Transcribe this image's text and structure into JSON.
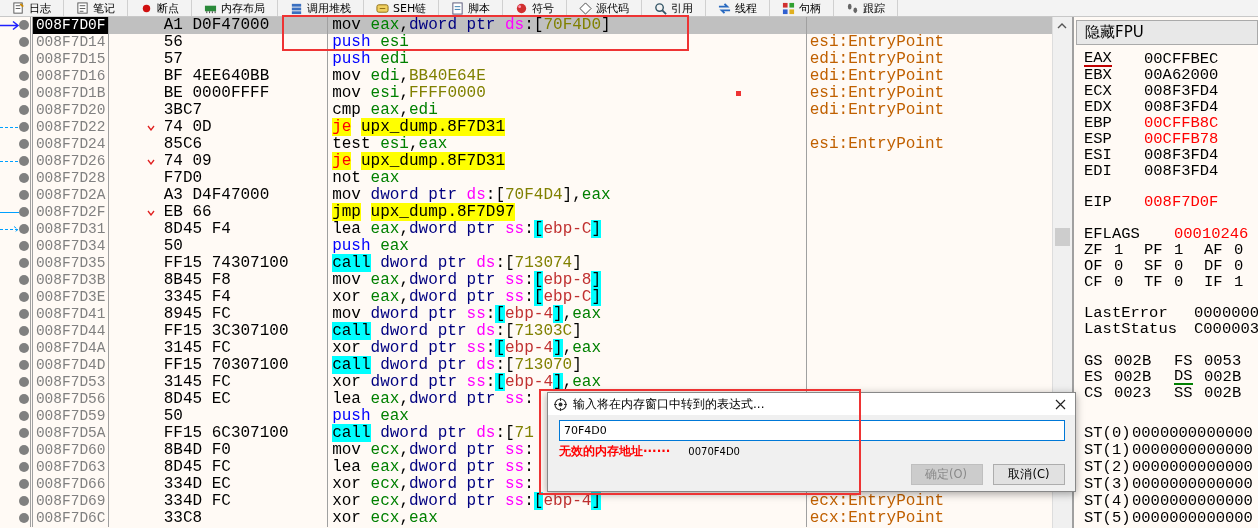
{
  "toolbar": {
    "tabs": [
      {
        "label": "日志"
      },
      {
        "label": "笔记"
      },
      {
        "label": "断点"
      },
      {
        "label": "内存布局"
      },
      {
        "label": "调用堆栈"
      },
      {
        "label": "SEH链"
      },
      {
        "label": "脚本"
      },
      {
        "label": "符号"
      },
      {
        "label": "源代码"
      },
      {
        "label": "引用"
      },
      {
        "label": "线程"
      },
      {
        "label": "句柄"
      },
      {
        "label": "跟踪"
      }
    ]
  },
  "disassembly": {
    "rows": [
      {
        "address": "008F7D0F",
        "bytes": "A1 D0F47000",
        "selected": true,
        "jump": false,
        "marker": {
          "kind": "eip"
        },
        "tokens": [
          {
            "kind": "plain",
            "text": "mov "
          },
          {
            "kind": "reg",
            "text": "eax"
          },
          {
            "kind": "plain",
            "text": ","
          },
          {
            "kind": "size",
            "text": "dword ptr "
          },
          {
            "kind": "seg",
            "text": "ds"
          },
          {
            "kind": "plain",
            "text": ":["
          },
          {
            "kind": "num",
            "text": "70F4D0"
          },
          {
            "kind": "plain",
            "text": "]"
          }
        ]
      },
      {
        "address": "008F7D14",
        "bytes": "56",
        "selected": false,
        "jump": false,
        "tokens": [
          {
            "kind": "push",
            "text": "push "
          },
          {
            "kind": "reg",
            "text": "esi"
          }
        ],
        "comment": "esi:EntryPoint"
      },
      {
        "address": "008F7D15",
        "bytes": "57",
        "selected": false,
        "jump": false,
        "tokens": [
          {
            "kind": "push",
            "text": "push "
          },
          {
            "kind": "reg",
            "text": "edi"
          }
        ],
        "comment": "edi:EntryPoint"
      },
      {
        "address": "008F7D16",
        "bytes": "BF 4EE640BB",
        "selected": false,
        "jump": false,
        "tokens": [
          {
            "kind": "plain",
            "text": "mov "
          },
          {
            "kind": "reg",
            "text": "edi"
          },
          {
            "kind": "plain",
            "text": ","
          },
          {
            "kind": "num",
            "text": "BB40E64E"
          }
        ],
        "comment": "edi:EntryPoint"
      },
      {
        "address": "008F7D1B",
        "bytes": "BE 0000FFFF",
        "selected": false,
        "jump": false,
        "tokens": [
          {
            "kind": "plain",
            "text": "mov "
          },
          {
            "kind": "reg",
            "text": "esi"
          },
          {
            "kind": "plain",
            "text": ","
          },
          {
            "kind": "num",
            "text": "FFFF0000"
          }
        ],
        "comment": "esi:EntryPoint"
      },
      {
        "address": "008F7D20",
        "bytes": "3BC7",
        "selected": false,
        "jump": false,
        "tokens": [
          {
            "kind": "plain",
            "text": "cmp "
          },
          {
            "kind": "reg",
            "text": "eax"
          },
          {
            "kind": "plain",
            "text": ","
          },
          {
            "kind": "reg",
            "text": "edi"
          }
        ],
        "comment": "edi:EntryPoint"
      },
      {
        "address": "008F7D22",
        "bytes": "74 0D",
        "selected": false,
        "jump": true,
        "marker": {
          "kind": "branch_dashed"
        },
        "tokens": [
          {
            "kind": "jcc",
            "text": "je "
          },
          {
            "kind": "target",
            "text": "upx_dump.8F7D31"
          }
        ]
      },
      {
        "address": "008F7D24",
        "bytes": "85C6",
        "selected": false,
        "jump": false,
        "tokens": [
          {
            "kind": "plain",
            "text": "test "
          },
          {
            "kind": "reg",
            "text": "esi"
          },
          {
            "kind": "plain",
            "text": ","
          },
          {
            "kind": "reg",
            "text": "eax"
          }
        ],
        "comment": "esi:EntryPoint"
      },
      {
        "address": "008F7D26",
        "bytes": "74 09",
        "selected": false,
        "jump": true,
        "marker": {
          "kind": "branch_dashed"
        },
        "tokens": [
          {
            "kind": "jcc",
            "text": "je "
          },
          {
            "kind": "target",
            "text": "upx_dump.8F7D31"
          }
        ]
      },
      {
        "address": "008F7D28",
        "bytes": "F7D0",
        "selected": false,
        "jump": false,
        "tokens": [
          {
            "kind": "plain",
            "text": "not "
          },
          {
            "kind": "reg",
            "text": "eax"
          }
        ]
      },
      {
        "address": "008F7D2A",
        "bytes": "A3 D4F47000",
        "selected": false,
        "jump": false,
        "tokens": [
          {
            "kind": "plain",
            "text": "mov "
          },
          {
            "kind": "size",
            "text": "dword ptr "
          },
          {
            "kind": "seg",
            "text": "ds"
          },
          {
            "kind": "plain",
            "text": ":["
          },
          {
            "kind": "num",
            "text": "70F4D4"
          },
          {
            "kind": "plain",
            "text": "],"
          },
          {
            "kind": "reg",
            "text": "eax"
          }
        ]
      },
      {
        "address": "008F7D2F",
        "bytes": "EB 66",
        "selected": false,
        "jump": true,
        "marker": {
          "kind": "branch_solid"
        },
        "tokens": [
          {
            "kind": "jmp",
            "text": "jmp "
          },
          {
            "kind": "target",
            "text": "upx_dump.8F7D97"
          }
        ]
      },
      {
        "address": "008F7D31",
        "bytes": "8D45 F4",
        "selected": false,
        "jump": false,
        "marker": {
          "kind": "target_dashed"
        },
        "tokens": [
          {
            "kind": "plain",
            "text": "lea "
          },
          {
            "kind": "reg",
            "text": "eax"
          },
          {
            "kind": "plain",
            "text": ","
          },
          {
            "kind": "size",
            "text": "dword ptr "
          },
          {
            "kind": "seg",
            "text": "ss"
          },
          {
            "kind": "plain",
            "text": ":"
          },
          {
            "kind": "mbr",
            "text": "["
          },
          {
            "kind": "stk",
            "text": "ebp-C"
          },
          {
            "kind": "mbr",
            "text": "]"
          }
        ]
      },
      {
        "address": "008F7D34",
        "bytes": "50",
        "selected": false,
        "jump": false,
        "tokens": [
          {
            "kind": "push",
            "text": "push "
          },
          {
            "kind": "reg",
            "text": "eax"
          }
        ]
      },
      {
        "address": "008F7D35",
        "bytes": "FF15 74307100",
        "selected": false,
        "jump": false,
        "tokens": [
          {
            "kind": "call",
            "text": "call "
          },
          {
            "kind": "size",
            "text": "dword ptr "
          },
          {
            "kind": "seg",
            "text": "ds"
          },
          {
            "kind": "plain",
            "text": ":["
          },
          {
            "kind": "num",
            "text": "713074"
          },
          {
            "kind": "plain",
            "text": "]"
          }
        ]
      },
      {
        "address": "008F7D3B",
        "bytes": "8B45 F8",
        "selected": false,
        "jump": false,
        "tokens": [
          {
            "kind": "plain",
            "text": "mov "
          },
          {
            "kind": "reg",
            "text": "eax"
          },
          {
            "kind": "plain",
            "text": ","
          },
          {
            "kind": "size",
            "text": "dword ptr "
          },
          {
            "kind": "seg",
            "text": "ss"
          },
          {
            "kind": "plain",
            "text": ":"
          },
          {
            "kind": "mbr",
            "text": "["
          },
          {
            "kind": "stk",
            "text": "ebp-8"
          },
          {
            "kind": "mbr",
            "text": "]"
          }
        ]
      },
      {
        "address": "008F7D3E",
        "bytes": "3345 F4",
        "selected": false,
        "jump": false,
        "tokens": [
          {
            "kind": "plain",
            "text": "xor "
          },
          {
            "kind": "reg",
            "text": "eax"
          },
          {
            "kind": "plain",
            "text": ","
          },
          {
            "kind": "size",
            "text": "dword ptr "
          },
          {
            "kind": "seg",
            "text": "ss"
          },
          {
            "kind": "plain",
            "text": ":"
          },
          {
            "kind": "mbr",
            "text": "["
          },
          {
            "kind": "stk",
            "text": "ebp-C"
          },
          {
            "kind": "mbr",
            "text": "]"
          }
        ]
      },
      {
        "address": "008F7D41",
        "bytes": "8945 FC",
        "selected": false,
        "jump": false,
        "tokens": [
          {
            "kind": "plain",
            "text": "mov "
          },
          {
            "kind": "size",
            "text": "dword ptr "
          },
          {
            "kind": "seg",
            "text": "ss"
          },
          {
            "kind": "plain",
            "text": ":"
          },
          {
            "kind": "mbr",
            "text": "["
          },
          {
            "kind": "stk",
            "text": "ebp-4"
          },
          {
            "kind": "mbr",
            "text": "]"
          },
          {
            "kind": "plain",
            "text": ","
          },
          {
            "kind": "reg",
            "text": "eax"
          }
        ]
      },
      {
        "address": "008F7D44",
        "bytes": "FF15 3C307100",
        "selected": false,
        "jump": false,
        "tokens": [
          {
            "kind": "call",
            "text": "call "
          },
          {
            "kind": "size",
            "text": "dword ptr "
          },
          {
            "kind": "seg",
            "text": "ds"
          },
          {
            "kind": "plain",
            "text": ":["
          },
          {
            "kind": "num",
            "text": "71303C"
          },
          {
            "kind": "plain",
            "text": "]"
          }
        ]
      },
      {
        "address": "008F7D4A",
        "bytes": "3145 FC",
        "selected": false,
        "jump": false,
        "tokens": [
          {
            "kind": "plain",
            "text": "xor "
          },
          {
            "kind": "size",
            "text": "dword ptr "
          },
          {
            "kind": "seg",
            "text": "ss"
          },
          {
            "kind": "plain",
            "text": ":"
          },
          {
            "kind": "mbr",
            "text": "["
          },
          {
            "kind": "stk",
            "text": "ebp-4"
          },
          {
            "kind": "mbr",
            "text": "]"
          },
          {
            "kind": "plain",
            "text": ","
          },
          {
            "kind": "reg",
            "text": "eax"
          }
        ]
      },
      {
        "address": "008F7D4D",
        "bytes": "FF15 70307100",
        "selected": false,
        "jump": false,
        "tokens": [
          {
            "kind": "call",
            "text": "call "
          },
          {
            "kind": "size",
            "text": "dword ptr "
          },
          {
            "kind": "seg",
            "text": "ds"
          },
          {
            "kind": "plain",
            "text": ":["
          },
          {
            "kind": "num",
            "text": "713070"
          },
          {
            "kind": "plain",
            "text": "]"
          }
        ]
      },
      {
        "address": "008F7D53",
        "bytes": "3145 FC",
        "selected": false,
        "jump": false,
        "tokens": [
          {
            "kind": "plain",
            "text": "xor "
          },
          {
            "kind": "size",
            "text": "dword ptr "
          },
          {
            "kind": "seg",
            "text": "ss"
          },
          {
            "kind": "plain",
            "text": ":"
          },
          {
            "kind": "mbr",
            "text": "["
          },
          {
            "kind": "stk",
            "text": "ebp-4"
          },
          {
            "kind": "mbr",
            "text": "]"
          },
          {
            "kind": "plain",
            "text": ","
          },
          {
            "kind": "reg",
            "text": "eax"
          }
        ]
      },
      {
        "address": "008F7D56",
        "bytes": "8D45 EC",
        "selected": false,
        "jump": false,
        "tokens": [
          {
            "kind": "plain",
            "text": "lea "
          },
          {
            "kind": "reg",
            "text": "eax"
          },
          {
            "kind": "plain",
            "text": ","
          },
          {
            "kind": "size",
            "text": "dword ptr "
          },
          {
            "kind": "seg",
            "text": "ss"
          },
          {
            "kind": "plain",
            "text": ":"
          }
        ]
      },
      {
        "address": "008F7D59",
        "bytes": "50",
        "selected": false,
        "jump": false,
        "tokens": [
          {
            "kind": "push",
            "text": "push "
          },
          {
            "kind": "reg",
            "text": "eax"
          }
        ]
      },
      {
        "address": "008F7D5A",
        "bytes": "FF15 6C307100",
        "selected": false,
        "jump": false,
        "tokens": [
          {
            "kind": "call",
            "text": "call "
          },
          {
            "kind": "size",
            "text": "dword ptr "
          },
          {
            "kind": "seg",
            "text": "ds"
          },
          {
            "kind": "plain",
            "text": ":["
          },
          {
            "kind": "num",
            "text": "71"
          }
        ]
      },
      {
        "address": "008F7D60",
        "bytes": "8B4D F0",
        "selected": false,
        "jump": false,
        "tokens": [
          {
            "kind": "plain",
            "text": "mov "
          },
          {
            "kind": "reg",
            "text": "ecx"
          },
          {
            "kind": "plain",
            "text": ","
          },
          {
            "kind": "size",
            "text": "dword ptr "
          },
          {
            "kind": "seg",
            "text": "ss"
          },
          {
            "kind": "plain",
            "text": ":"
          }
        ]
      },
      {
        "address": "008F7D63",
        "bytes": "8D45 FC",
        "selected": false,
        "jump": false,
        "tokens": [
          {
            "kind": "plain",
            "text": "lea "
          },
          {
            "kind": "reg",
            "text": "eax"
          },
          {
            "kind": "plain",
            "text": ","
          },
          {
            "kind": "size",
            "text": "dword ptr "
          },
          {
            "kind": "seg",
            "text": "ss"
          },
          {
            "kind": "plain",
            "text": ":"
          }
        ]
      },
      {
        "address": "008F7D66",
        "bytes": "334D EC",
        "selected": false,
        "jump": false,
        "tokens": [
          {
            "kind": "plain",
            "text": "xor "
          },
          {
            "kind": "reg",
            "text": "ecx"
          },
          {
            "kind": "plain",
            "text": ","
          },
          {
            "kind": "size",
            "text": "dword ptr "
          },
          {
            "kind": "seg",
            "text": "ss"
          },
          {
            "kind": "plain",
            "text": ":"
          }
        ]
      },
      {
        "address": "008F7D69",
        "bytes": "334D FC",
        "selected": false,
        "jump": false,
        "tokens": [
          {
            "kind": "plain",
            "text": "xor "
          },
          {
            "kind": "reg",
            "text": "ecx"
          },
          {
            "kind": "plain",
            "text": ","
          },
          {
            "kind": "size",
            "text": "dword ptr "
          },
          {
            "kind": "seg",
            "text": "ss"
          },
          {
            "kind": "plain",
            "text": ":"
          },
          {
            "kind": "mbr",
            "text": "["
          },
          {
            "kind": "stk",
            "text": "ebp-4"
          },
          {
            "kind": "mbr",
            "text": "]"
          }
        ],
        "comment": "ecx:EntryPoint"
      },
      {
        "address": "008F7D6C",
        "bytes": "33C8",
        "selected": false,
        "jump": false,
        "tokens": [
          {
            "kind": "plain",
            "text": "xor "
          },
          {
            "kind": "reg",
            "text": "ecx"
          },
          {
            "kind": "plain",
            "text": ","
          },
          {
            "kind": "reg",
            "text": "eax"
          }
        ],
        "comment": "ecx:EntryPoint"
      }
    ]
  },
  "registers": {
    "toggle": "隐藏FPU",
    "general": [
      {
        "name": "EAX",
        "value": "00CFFBEC",
        "changed": false,
        "underlined": true
      },
      {
        "name": "EBX",
        "value": "00A62000",
        "changed": false,
        "underlined": false
      },
      {
        "name": "ECX",
        "value": "008F3FD4",
        "changed": false,
        "underlined": false
      },
      {
        "name": "EDX",
        "value": "008F3FD4",
        "changed": false,
        "underlined": false
      },
      {
        "name": "EBP",
        "value": "00CFFB8C",
        "changed": true,
        "underlined": false
      },
      {
        "name": "ESP",
        "value": "00CFFB78",
        "changed": true,
        "underlined": false
      },
      {
        "name": "ESI",
        "value": "008F3FD4",
        "changed": false,
        "underlined": false
      },
      {
        "name": "EDI",
        "value": "008F3FD4",
        "changed": false,
        "underlined": false
      }
    ],
    "eip": {
      "name": "EIP",
      "value": "008F7D0F",
      "changed": true
    },
    "eflags": {
      "name": "EFLAGS",
      "value": "00010246",
      "changed": true
    },
    "flags": [
      {
        "name": "ZF",
        "value": "1"
      },
      {
        "name": "PF",
        "value": "1"
      },
      {
        "name": "AF",
        "value": "0"
      },
      {
        "name": "OF",
        "value": "0"
      },
      {
        "name": "SF",
        "value": "0"
      },
      {
        "name": "DF",
        "value": "0"
      },
      {
        "name": "CF",
        "value": "0"
      },
      {
        "name": "TF",
        "value": "0"
      },
      {
        "name": "IF",
        "value": "1"
      }
    ],
    "status": [
      {
        "name": "LastError",
        "value": "0000000"
      },
      {
        "name": "LastStatus",
        "value": "C000003"
      }
    ],
    "segments": [
      {
        "name": "GS",
        "value": "002B",
        "underlined": false
      },
      {
        "name": "FS",
        "value": "0053",
        "underlined": false
      },
      {
        "name": "ES",
        "value": "002B",
        "underlined": false
      },
      {
        "name": "DS",
        "value": "002B",
        "underlined": true
      },
      {
        "name": "CS",
        "value": "0023",
        "underlined": false
      },
      {
        "name": "SS",
        "value": "002B",
        "underlined": false
      }
    ],
    "fpu": [
      {
        "name": "ST(0)",
        "value": "0000000000000"
      },
      {
        "name": "ST(1)",
        "value": "0000000000000"
      },
      {
        "name": "ST(2)",
        "value": "0000000000000"
      },
      {
        "name": "ST(3)",
        "value": "0000000000000"
      },
      {
        "name": "ST(4)",
        "value": "0000000000000"
      },
      {
        "name": "ST(5)",
        "value": "0000000000000"
      }
    ]
  },
  "dialog": {
    "title": "输入将在内存窗口中转到的表达式...",
    "input": {
      "value": "70F4D0"
    },
    "error": "无效的内存地址······",
    "resolved": "0070F4D0",
    "buttons": [
      {
        "label": "确定(O)",
        "disabled": true
      },
      {
        "label": "取消(C)",
        "disabled": false
      }
    ]
  }
}
